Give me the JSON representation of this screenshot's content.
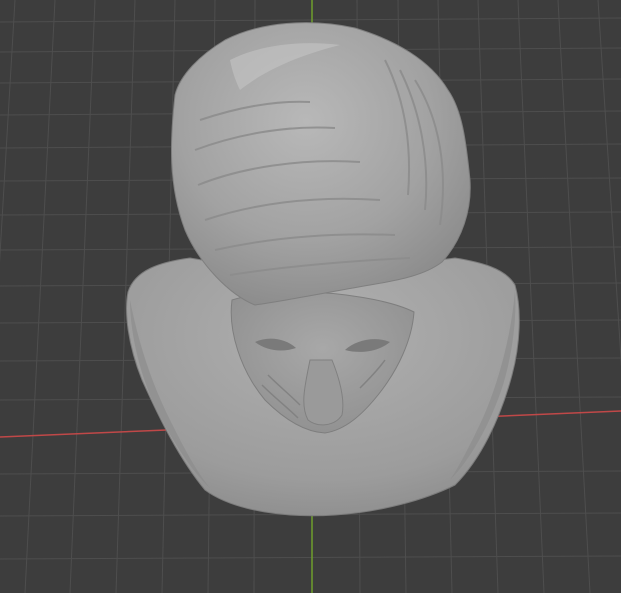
{
  "viewport": {
    "view": "3d-viewport-perspective",
    "background_color": "#3d3d3d",
    "grid": {
      "visible": true,
      "line_color": "#4e4e4e",
      "minor_line_color": "#474747"
    },
    "axes": {
      "x_axis_color": "#c04848",
      "y_axis_color": "#6f9e2c"
    },
    "object": {
      "type": "sculpted-bust-mesh",
      "shading": "solid-clay",
      "base_color": "#a3a3a3"
    }
  }
}
